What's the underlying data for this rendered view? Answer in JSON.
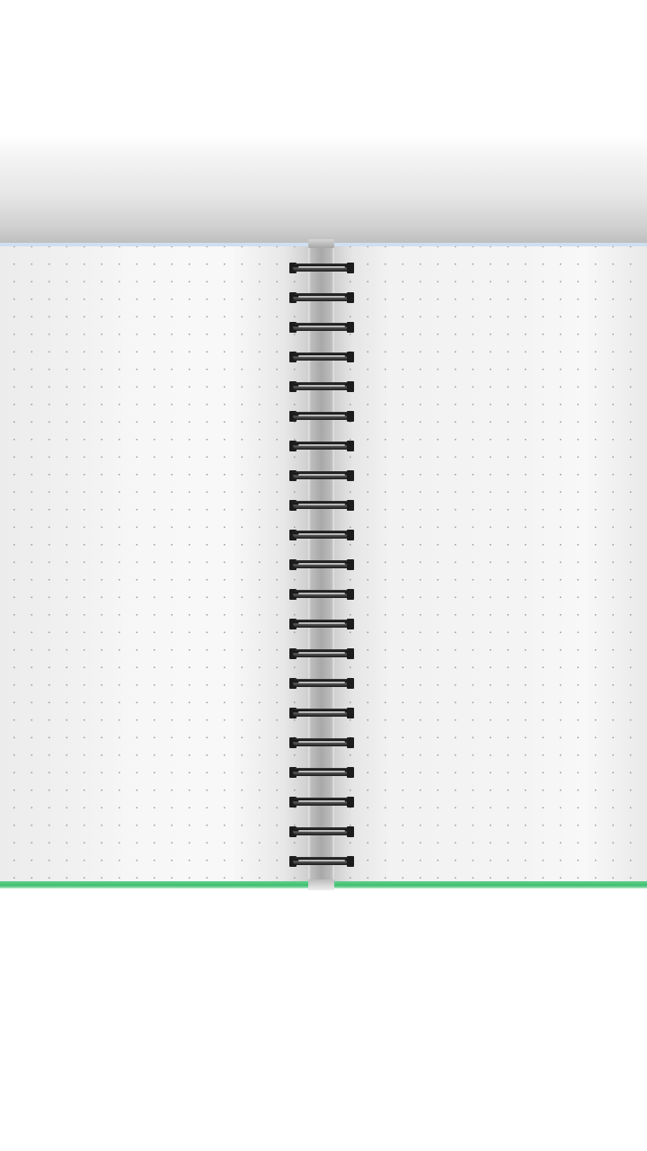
{
  "notebook": {
    "style": "dot-grid spiral notebook, open spread",
    "colors": {
      "background": "#ffffff",
      "page": "#f6f6f6",
      "dot": "#9a9a9a",
      "top_edge": "#cfdff0",
      "bottom_edge": "#3fbf72",
      "spine": "#a8a8a8",
      "ring": "#1a1a1a"
    },
    "pages": [
      {
        "name": "left-page"
      },
      {
        "name": "right-page"
      }
    ],
    "rings": 21
  }
}
